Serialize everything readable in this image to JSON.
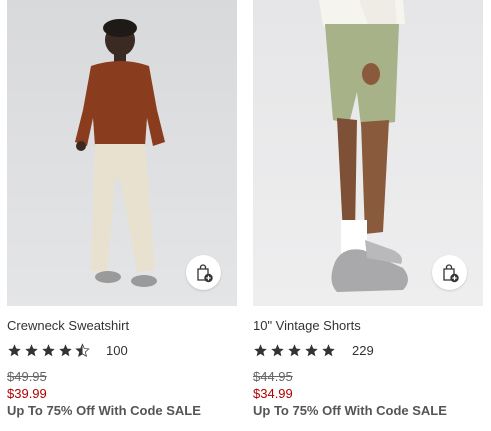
{
  "products": [
    {
      "name": "Crewneck Sweatshirt",
      "rating": 4.5,
      "review_count": "100",
      "original_price": "$49.95",
      "sale_price": "$39.99",
      "promo": "Up To 75% Off With Code SALE",
      "image_icon": "model-in-rust-sweatshirt-photo",
      "action_icon": "add-to-bag-icon"
    },
    {
      "name": "10\" Vintage Shorts",
      "rating": 5,
      "review_count": "229",
      "original_price": "$44.95",
      "sale_price": "$34.99",
      "promo": "Up To 75% Off With Code SALE",
      "image_icon": "model-in-green-shorts-photo",
      "action_icon": "add-to-bag-icon"
    }
  ],
  "colors": {
    "sale_price": "#b30000",
    "text": "#333333",
    "star": "#333333"
  }
}
